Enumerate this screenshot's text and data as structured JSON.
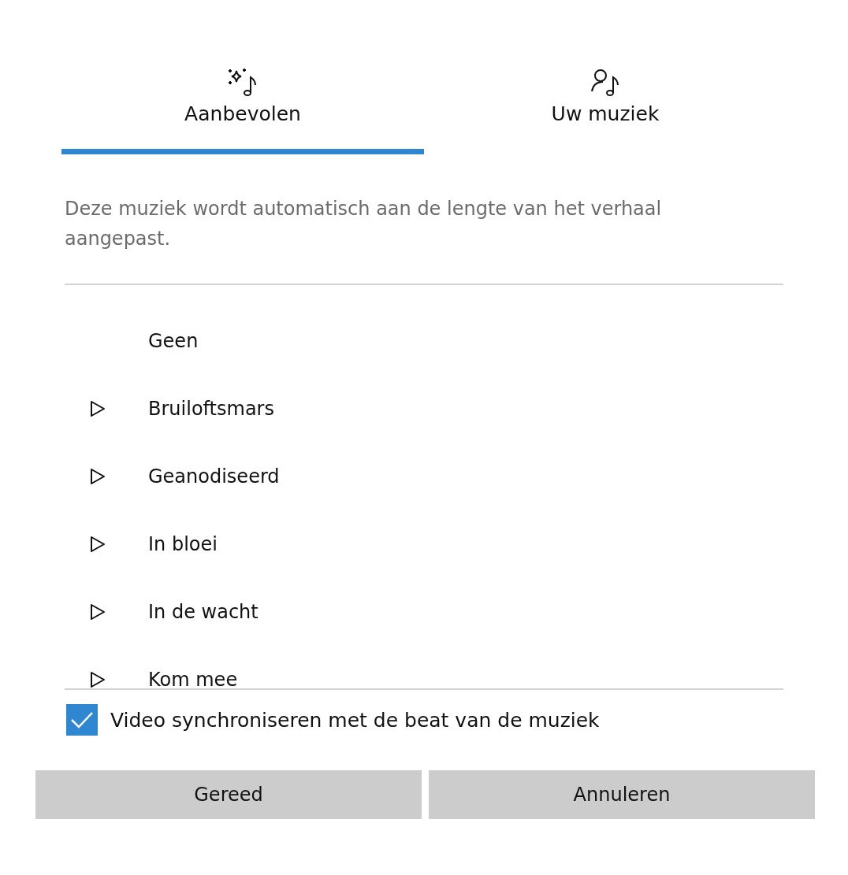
{
  "tabs": [
    {
      "label": "Aanbevolen",
      "kind": "sparkle",
      "selected": true
    },
    {
      "label": "Uw muziek",
      "kind": "person",
      "selected": false
    }
  ],
  "description": "Deze muziek wordt automatisch aan de lengte van het verhaal aangepast.",
  "tracks": [
    {
      "kind": "none",
      "title": "Geen"
    },
    {
      "kind": "song",
      "title": "Bruiloftsmars"
    },
    {
      "kind": "song",
      "title": "Geanodiseerd"
    },
    {
      "kind": "song",
      "title": "In bloei"
    },
    {
      "kind": "song",
      "title": "In de wacht"
    },
    {
      "kind": "song",
      "title": "Kom mee"
    }
  ],
  "sync": {
    "label": "Video synchroniseren met de beat van de muziek",
    "checked": true
  },
  "buttons": [
    "Gereed",
    "Annuleren"
  ]
}
